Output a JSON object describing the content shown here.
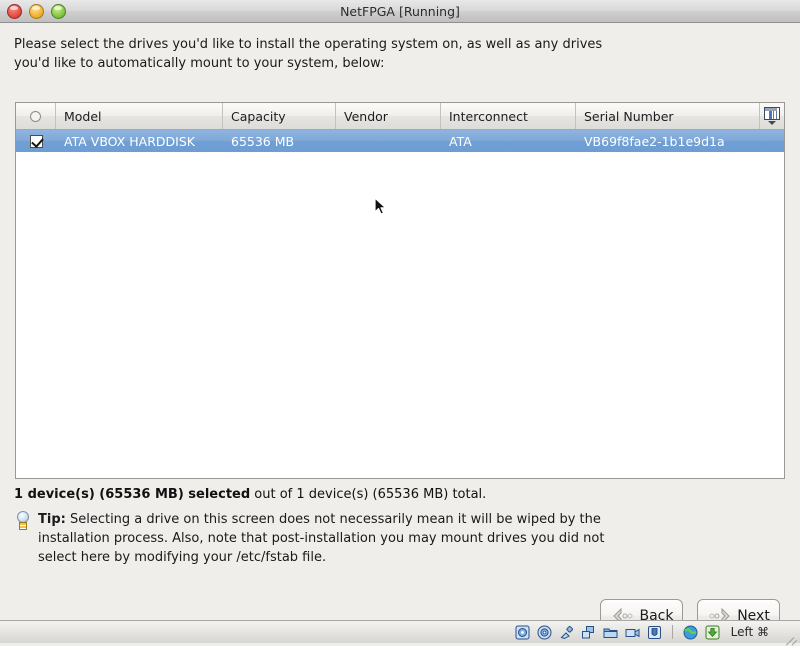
{
  "window": {
    "title": "NetFPGA [Running]",
    "controls": [
      "close",
      "minimize",
      "zoom"
    ]
  },
  "instructions": {
    "line1": "Please select the drives you'd like to install the operating system on, as well as any drives",
    "line2": "you'd like to automatically mount to your system, below:"
  },
  "table": {
    "columns": [
      {
        "key": "select",
        "label": ""
      },
      {
        "key": "model",
        "label": "Model"
      },
      {
        "key": "capacity",
        "label": "Capacity"
      },
      {
        "key": "vendor",
        "label": "Vendor"
      },
      {
        "key": "interconnect",
        "label": "Interconnect"
      },
      {
        "key": "serial",
        "label": "Serial Number"
      }
    ],
    "rows": [
      {
        "checked": true,
        "selected": true,
        "model": "ATA VBOX HARDDISK",
        "capacity": "65536 MB",
        "vendor": "",
        "interconnect": "ATA",
        "serial": "VB69f8fae2-1b1e9d1a"
      }
    ]
  },
  "summary": {
    "bold": "1 device(s) (65536 MB) selected",
    "rest": " out of 1 device(s) (65536 MB) total."
  },
  "tip": {
    "label": "Tip:",
    "body": " Selecting a drive on this screen does not necessarily mean it will be wiped by the installation process.  Also, note that post-installation you may mount drives you did not select here by modifying your /etc/fstab file."
  },
  "buttons": {
    "back": "Back",
    "next": "Next"
  },
  "statusbar": {
    "icons": [
      "harddisk-icon",
      "optical-disk-icon",
      "usb-icon",
      "network-icon",
      "shared-folders-icon",
      "video-capture-icon",
      "remote-display-icon",
      "globe-icon",
      "download-icon"
    ],
    "host_key": "Left ⌘"
  },
  "colors": {
    "selection": "#7ea8d8",
    "table_border": "#9a9a94",
    "background": "#efeeeb",
    "text": "#1a1a1a"
  }
}
